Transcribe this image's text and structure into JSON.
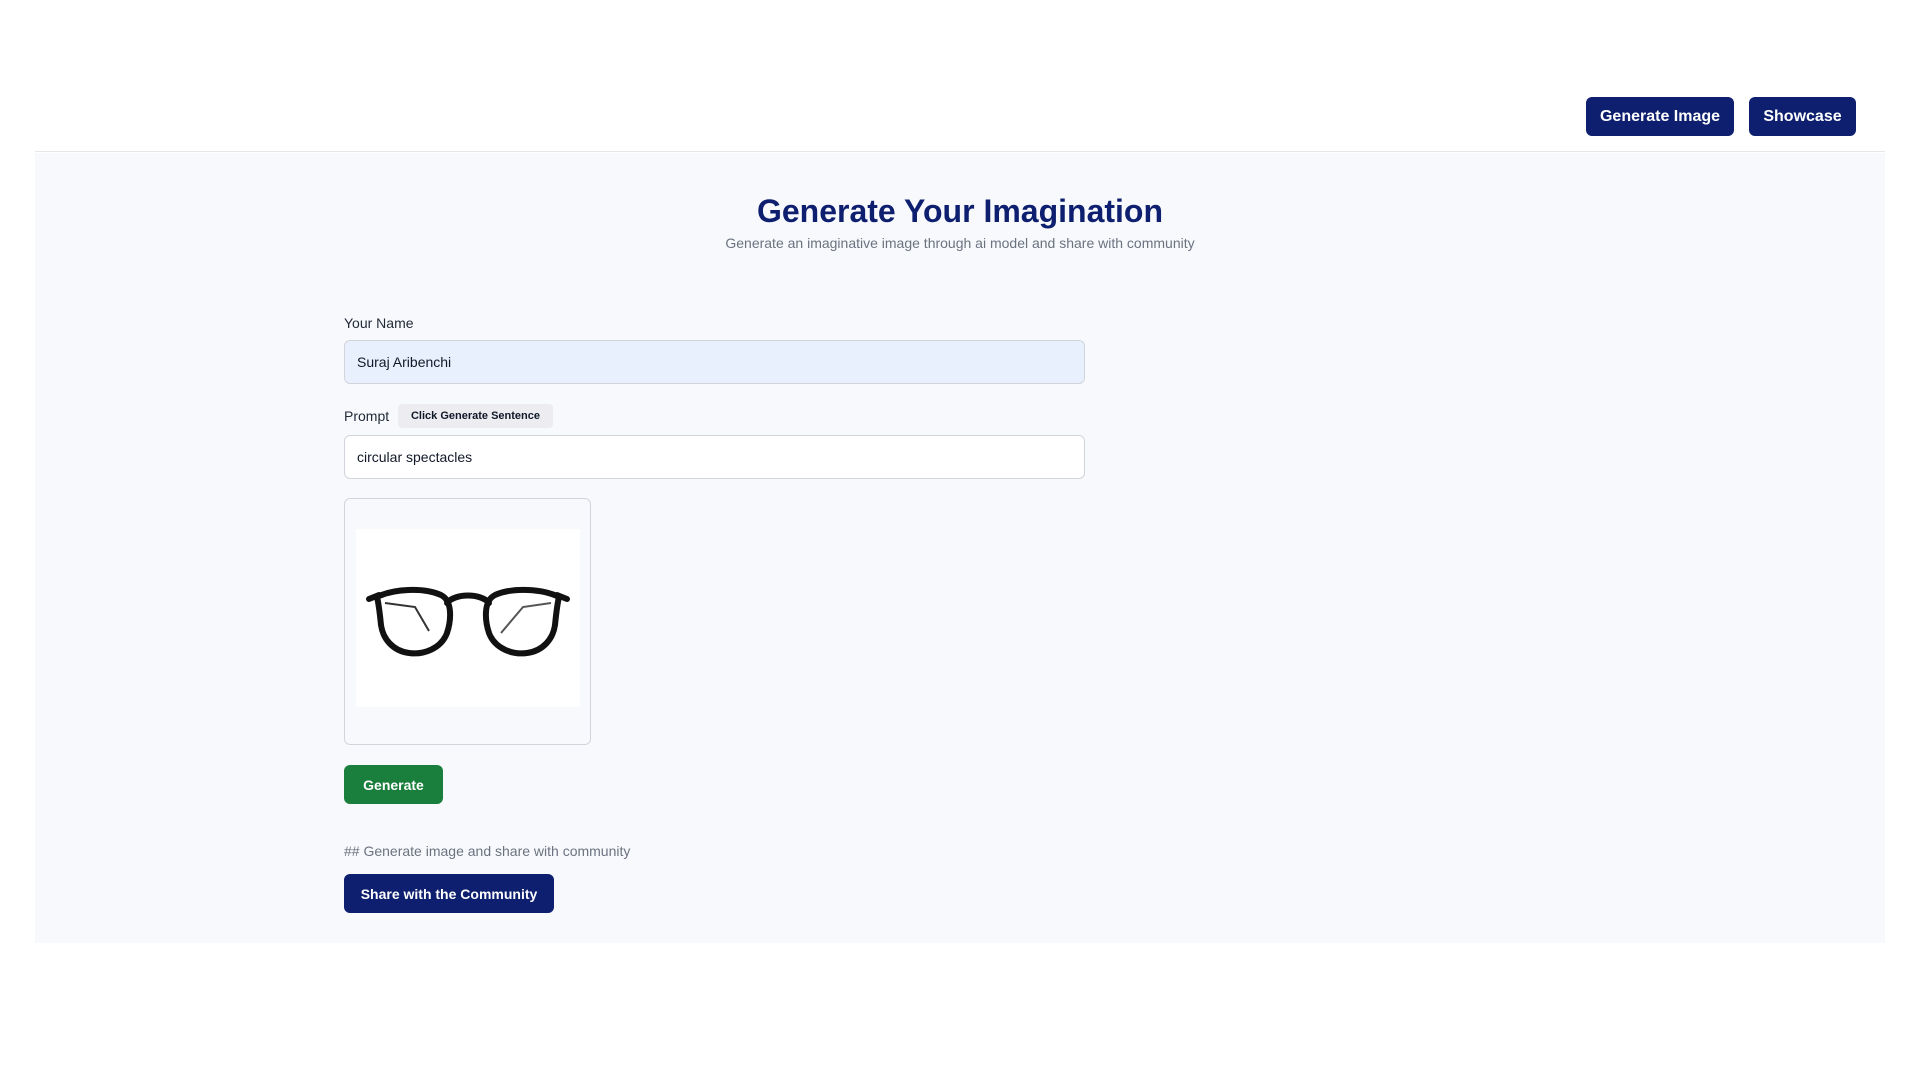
{
  "header": {
    "generate_image_label": "Generate Image",
    "showcase_label": "Showcase"
  },
  "main": {
    "title": "Generate Your Imagination",
    "subtitle": "Generate an imaginative image through ai model and share with community"
  },
  "form": {
    "name_label": "Your Name",
    "name_value": "Suraj Aribenchi",
    "prompt_label": "Prompt",
    "generate_sentence_label": "Click Generate Sentence",
    "prompt_value": "circular spectacles",
    "preview_icon": "spectacles-image",
    "generate_label": "Generate",
    "share_note": "## Generate image and share with community",
    "share_label": "Share with the Community"
  },
  "colors": {
    "primary": "#0d1f6e",
    "generate": "#1a7f3c",
    "name_field_bg": "#e8f0fe",
    "page_bg": "#f8f9fc"
  }
}
